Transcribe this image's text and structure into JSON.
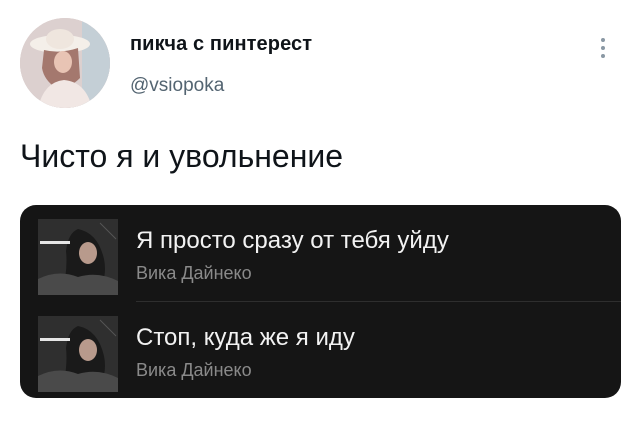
{
  "tweet": {
    "author_name": "пикча с пинтерест",
    "author_handle": "@vsiopoka",
    "text": "Чисто я и увольнение"
  },
  "icons": {
    "menu": "vertical-dots-icon"
  },
  "playlist": {
    "tracks": [
      {
        "title": "Я просто сразу от тебя уйду",
        "artist": "Вика Дайнеко"
      },
      {
        "title": "Стоп, куда же я иду",
        "artist": "Вика Дайнеко"
      }
    ]
  },
  "colors": {
    "playlist_background": "#151515",
    "primary_text": "#0f1419",
    "secondary_text": "#536471",
    "track_title": "#f2f2f2",
    "track_artist": "#8a8a8a"
  }
}
